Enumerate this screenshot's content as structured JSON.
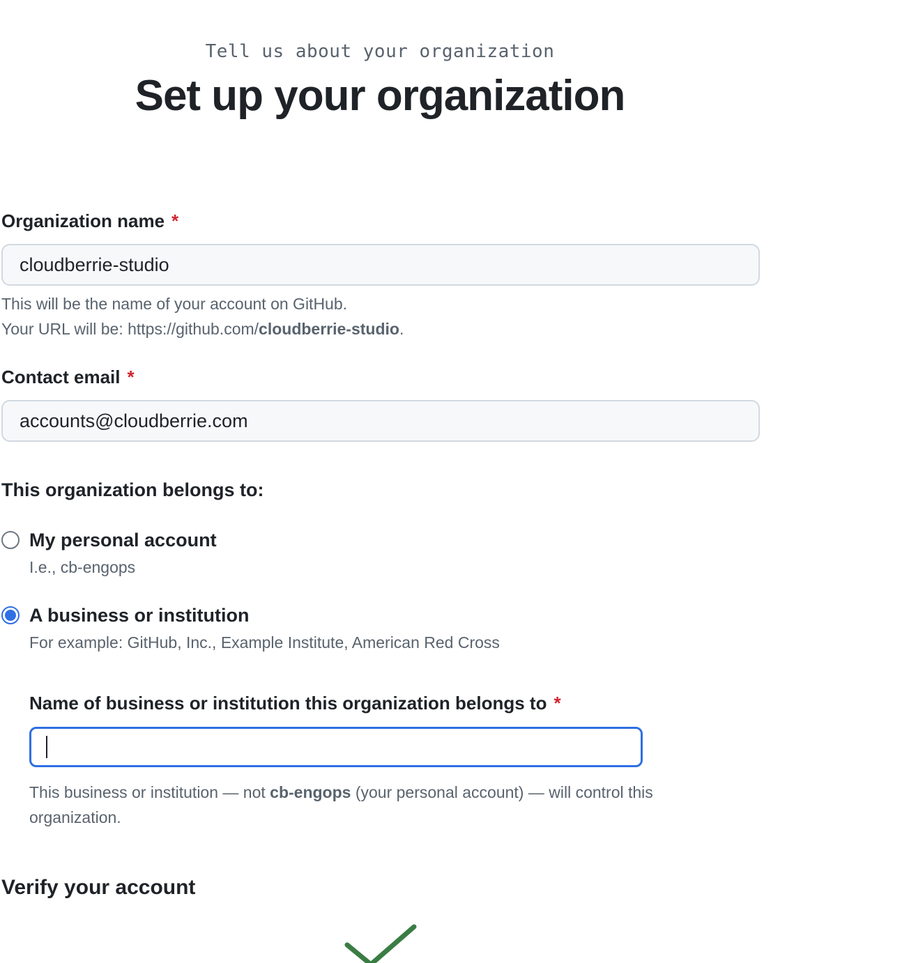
{
  "header": {
    "eyebrow": "Tell us about your organization",
    "title": "Set up your organization"
  },
  "org_name": {
    "label": "Organization name",
    "required_mark": "*",
    "value": "cloudberrie-studio",
    "hint_line1": "This will be the name of your account on GitHub.",
    "hint_url_prefix": "Your URL will be: https://github.com/",
    "hint_url_name": "cloudberrie-studio",
    "hint_url_suffix": "."
  },
  "contact_email": {
    "label": "Contact email",
    "required_mark": "*",
    "value": "accounts@cloudberrie.com"
  },
  "belongs_to": {
    "title": "This organization belongs to:",
    "options": [
      {
        "label": "My personal account",
        "description": "I.e., cb-engops",
        "checked": false
      },
      {
        "label": "A business or institution",
        "description": "For example: GitHub, Inc., Example Institute, American Red Cross",
        "checked": true
      }
    ]
  },
  "business_name": {
    "label": "Name of business or institution this organization belongs to",
    "required_mark": "*",
    "value": "",
    "hint_prefix": "This business or institution — not ",
    "hint_account": "cb-engops",
    "hint_suffix_line1": " (your personal account) — will control this",
    "hint_line2": "organization."
  },
  "verify": {
    "title": "Verify your account",
    "icon": "checkmark-icon",
    "icon_color": "#3a7d44"
  },
  "colors": {
    "accent": "#2f6fe4",
    "required": "#d1242f",
    "muted": "#59636e",
    "success": "#3a7d44"
  }
}
